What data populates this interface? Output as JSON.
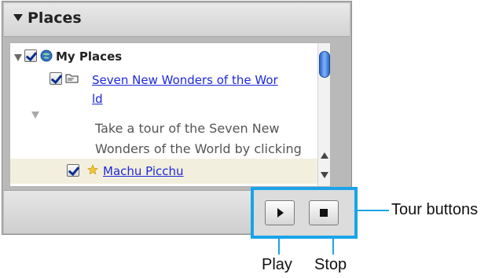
{
  "panel": {
    "title": "Places"
  },
  "tree": {
    "my_places": "My Places",
    "folder_link": {
      "line1": "Seven New Wonders of the Wor",
      "line2": "ld"
    },
    "description": {
      "line1": "Take a tour of the Seven New",
      "line2": "Wonders of the World by clicking"
    },
    "placemark": "Machu Picchu"
  },
  "callouts": {
    "tour_buttons": "Tour buttons",
    "play": "Play",
    "stop": "Stop"
  },
  "colors": {
    "callout": "#1aa3e8",
    "link": "#1c28d9",
    "selected_row": "#f3efdf"
  },
  "icons": [
    "expand-arrow-icon",
    "checkbox-icon",
    "globe-icon",
    "folder-icon",
    "star-icon",
    "play-icon",
    "stop-icon",
    "scroll-up-icon",
    "scroll-down-icon"
  ]
}
